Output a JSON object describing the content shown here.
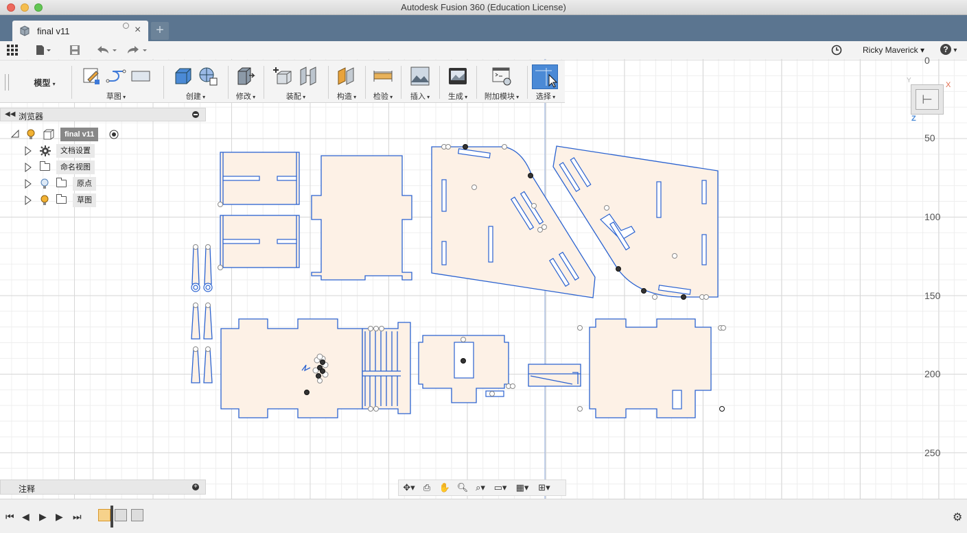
{
  "window": {
    "title": "Autodesk Fusion 360 (Education License)"
  },
  "tab": {
    "title": "final v11",
    "close": "×",
    "new": "+"
  },
  "quickbar": {
    "user": "Ricky Maverick",
    "user_caret": "▾",
    "help": "?",
    "help_caret": "▾"
  },
  "ribbon": {
    "workspace": "模型",
    "groups": [
      {
        "name": "sketch",
        "label": "草图"
      },
      {
        "name": "create",
        "label": "创建"
      },
      {
        "name": "modify",
        "label": "修改"
      },
      {
        "name": "assemble",
        "label": "装配"
      },
      {
        "name": "construct",
        "label": "构造"
      },
      {
        "name": "inspect",
        "label": "检验"
      },
      {
        "name": "insert",
        "label": "插入"
      },
      {
        "name": "make",
        "label": "生成"
      },
      {
        "name": "addins",
        "label": "附加模块"
      },
      {
        "name": "select",
        "label": "选择"
      }
    ]
  },
  "browser": {
    "title": "浏览器",
    "root": "final v11",
    "items": [
      {
        "label": "文档设置",
        "icon": "gear-icon"
      },
      {
        "label": "命名视图",
        "icon": "folder-icon"
      },
      {
        "label": "原点",
        "icon": "folder-icon"
      },
      {
        "label": "草图",
        "icon": "folder-icon"
      }
    ]
  },
  "comments": {
    "title": "注释"
  },
  "ruler": {
    "ticks": [
      "0",
      "50",
      "100",
      "150",
      "200",
      "250"
    ]
  },
  "viewcube": {
    "x_label": "X",
    "y_label": "Y",
    "z_label": "Z"
  },
  "colors": {
    "accent": "#4b8ad6",
    "sketch_line": "#2a62d0",
    "profile_fill": "#fdf1e6",
    "tabbar": "#5b7590"
  }
}
